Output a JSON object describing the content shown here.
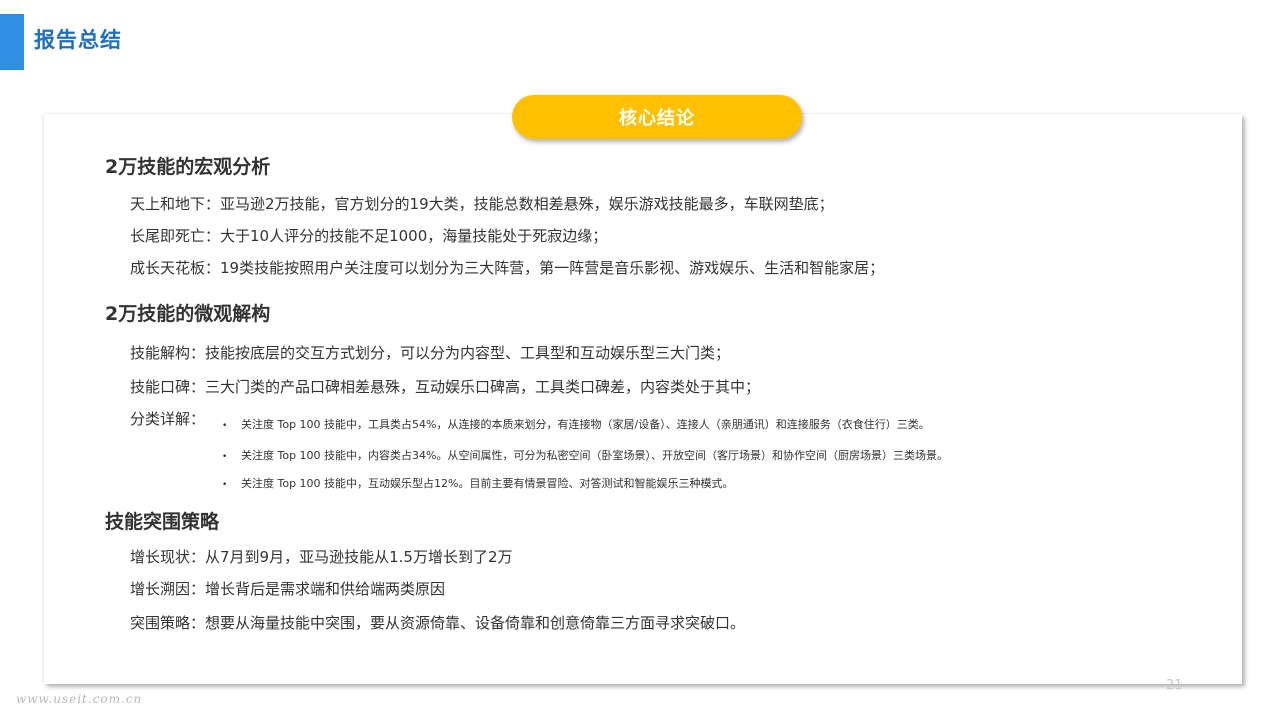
{
  "page_title": "报告总结",
  "badge": "核心结论",
  "sections": [
    {
      "heading": "2万技能的宏观分析",
      "lines": [
        "天上和地下：亚马逊2万技能，官方划分的19大类，技能总数相差悬殊，娱乐游戏技能最多，车联网垫底；",
        "长尾即死亡：大于10人评分的技能不足1000，海量技能处于死寂边缘；",
        "成长天花板：19类技能按照用户关注度可以划分为三大阵营，第一阵营是音乐影视、游戏娱乐、生活和智能家居；"
      ]
    },
    {
      "heading": "2万技能的微观解构",
      "lines": [
        "技能解构：技能按底层的交互方式划分，可以分为内容型、工具型和互动娱乐型三大门类；",
        "技能口碑：三大门类的产品口碑相差悬殊，互动娱乐口碑高，工具类口碑差，内容类处于其中；",
        "分类详解："
      ],
      "bullets": [
        "关注度 Top 100 技能中，工具类占54%，从连接的本质来划分，有连接物（家居/设备）、连接人（亲朋通讯）和连接服务（衣食住行）三类。",
        "关注度 Top 100 技能中，内容类占34%。从空间属性，可分为私密空间（卧室场景）、开放空间（客厅场景）和协作空间（厨房场景）三类场景。",
        "关注度 Top 100 技能中，互动娱乐型占12%。目前主要有情景冒险、对答测试和智能娱乐三种模式。"
      ]
    },
    {
      "heading": "技能突围策略",
      "lines": [
        "增长现状：从7月到9月，亚马逊技能从1.5万增长到了2万",
        "增长溯因：增长背后是需求端和供给端两类原因",
        "突围策略：想要从海量技能中突围，要从资源倚靠、设备倚靠和创意倚靠三方面寻求突破口。"
      ]
    }
  ],
  "bullet_symbol": "•",
  "page_number": "21",
  "watermark": "www.useit.com.cn",
  "colors": {
    "accent_blue": "#2f8fe0",
    "title_blue": "#1f6fbd",
    "badge_yellow": "#ffc000"
  }
}
